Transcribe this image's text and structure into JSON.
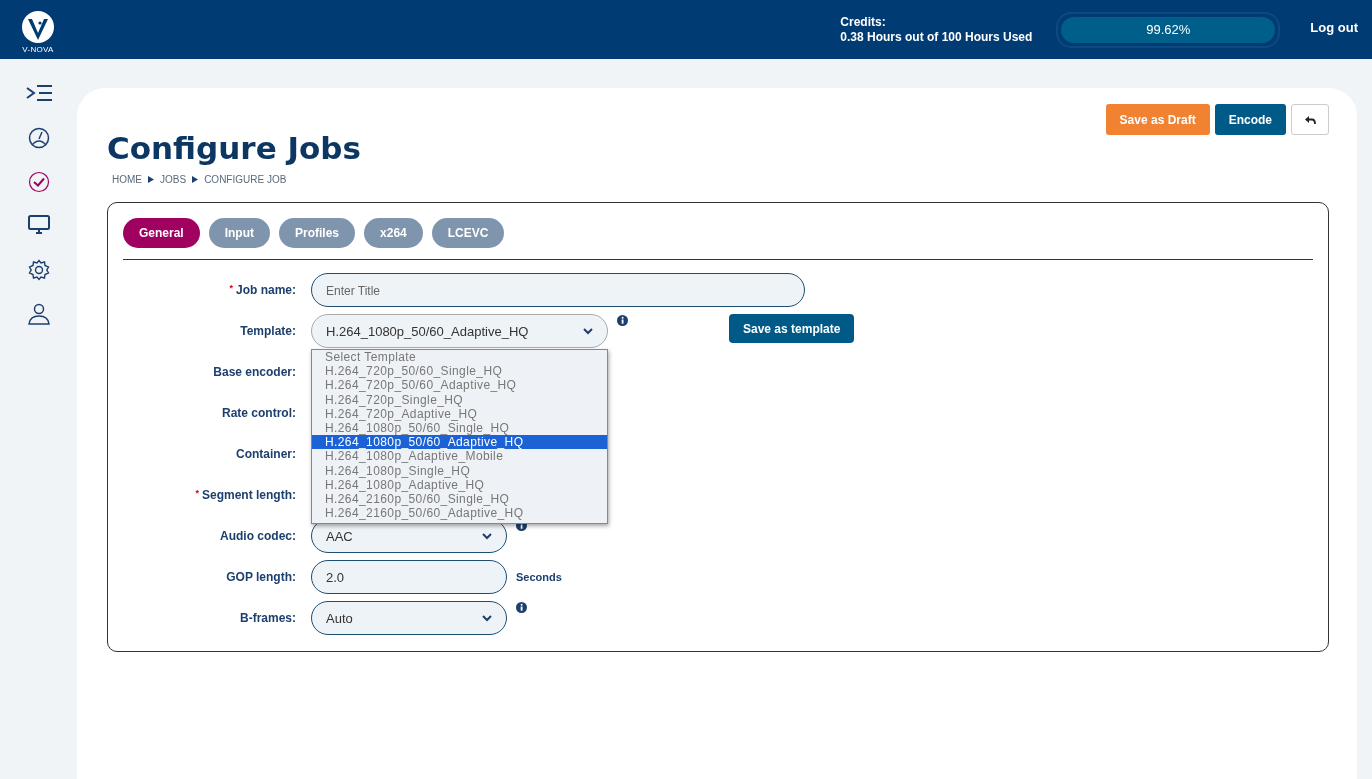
{
  "header": {
    "logo_text": "V-NOVA",
    "credits_label": "Credits:",
    "credits_usage": "0.38 Hours out of 100 Hours Used",
    "credits_meter": {
      "level": 0.9962,
      "reading": "99.62%"
    },
    "logout": "Log out"
  },
  "sidebar": {
    "items": [
      {
        "kind": "menu",
        "selected": false
      },
      {
        "kind": "dashboard",
        "selected": false
      },
      {
        "kind": "jobs",
        "selected": true
      },
      {
        "kind": "monitor",
        "selected": false
      },
      {
        "kind": "settings",
        "selected": false
      },
      {
        "kind": "user",
        "selected": false
      }
    ]
  },
  "actions": [
    {
      "label": "Save as Draft",
      "kind": "draft"
    },
    {
      "label": "Encode",
      "kind": "primary"
    },
    {
      "kind": "back"
    }
  ],
  "page": {
    "title": "Configure Jobs",
    "breadcrumb": [
      "HOME",
      "JOBS",
      "CONFIGURE JOB"
    ]
  },
  "tabs": [
    {
      "label": "General",
      "selected": true
    },
    {
      "label": "Input",
      "selected": false
    },
    {
      "label": "Profiles",
      "selected": false
    },
    {
      "label": "x264",
      "selected": false
    },
    {
      "label": "LCEVC",
      "selected": false
    }
  ],
  "form": {
    "fields": [
      {
        "label": "Job name:",
        "required_mark": "*",
        "kind": "wide_text",
        "placeholder": "Enter Title"
      },
      {
        "label": "Template:",
        "kind": "select",
        "value": "H.264_1080p_50/60_Adaptive_HQ",
        "info": true,
        "open": true,
        "action": "Save as template",
        "options": [
          {
            "label": "Select Template",
            "selected": false
          },
          {
            "label": "H.264_720p_50/60_Single_HQ",
            "selected": false
          },
          {
            "label": "H.264_720p_50/60_Adaptive_HQ",
            "selected": false
          },
          {
            "label": "H.264_720p_Single_HQ",
            "selected": false
          },
          {
            "label": "H.264_720p_Adaptive_HQ",
            "selected": false
          },
          {
            "label": "H.264_1080p_50/60_Single_HQ",
            "selected": false
          },
          {
            "label": "H.264_1080p_50/60_Adaptive_HQ",
            "selected": true
          },
          {
            "label": "H.264_1080p_Adaptive_Mobile",
            "selected": false
          },
          {
            "label": "H.264_1080p_Single_HQ",
            "selected": false
          },
          {
            "label": "H.264_1080p_Adaptive_HQ",
            "selected": false
          },
          {
            "label": "H.264_2160p_50/60_Single_HQ",
            "selected": false
          },
          {
            "label": "H.264_2160p_50/60_Adaptive_HQ",
            "selected": false
          }
        ]
      },
      {
        "label": "Base encoder:",
        "kind": "hidden"
      },
      {
        "label": "Rate control:",
        "kind": "hidden"
      },
      {
        "label": "Container:",
        "kind": "hidden"
      },
      {
        "label": "Segment length:",
        "required_mark": "*",
        "kind": "hidden"
      },
      {
        "label": "Audio codec:",
        "kind": "select",
        "value": "AAC",
        "info": true
      },
      {
        "label": "GOP length:",
        "kind": "text",
        "value": "2.0",
        "suffix": "Seconds"
      },
      {
        "label": "B-frames:",
        "kind": "select",
        "value": "Auto",
        "info": true
      }
    ]
  }
}
